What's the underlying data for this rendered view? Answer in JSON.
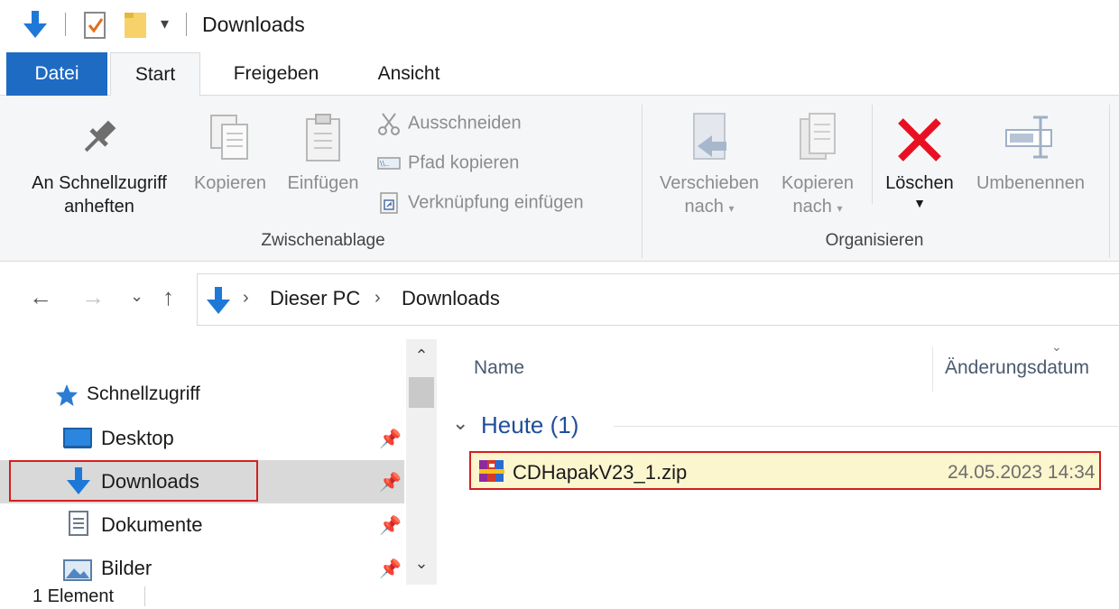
{
  "window": {
    "title": "Downloads"
  },
  "ribbon_tabs": [
    {
      "label": "Datei"
    },
    {
      "label": "Start"
    },
    {
      "label": "Freigeben"
    },
    {
      "label": "Ansicht"
    }
  ],
  "ribbon": {
    "pin_quick_access": {
      "line1": "An Schnellzugriff",
      "line2": "anheften"
    },
    "copy": "Kopieren",
    "paste": "Einfügen",
    "cut": "Ausschneiden",
    "copy_path": "Pfad kopieren",
    "paste_shortcut": "Verknüpfung einfügen",
    "clipboard_group": "Zwischenablage",
    "move_to": {
      "line1": "Verschieben",
      "line2": "nach"
    },
    "copy_to": {
      "line1": "Kopieren",
      "line2": "nach"
    },
    "delete": "Löschen",
    "rename": "Umbenennen",
    "organize_group": "Organisieren"
  },
  "address": {
    "breadcrumbs": [
      "Dieser PC",
      "Downloads"
    ]
  },
  "nav_pane": {
    "quick_access": "Schnellzugriff",
    "items": [
      {
        "label": "Desktop"
      },
      {
        "label": "Downloads"
      },
      {
        "label": "Dokumente"
      },
      {
        "label": "Bilder"
      }
    ]
  },
  "content": {
    "columns": {
      "name": "Name",
      "modified": "Änderungsdatum"
    },
    "group_header": "Heute (1)",
    "files": [
      {
        "name": "CDHapakV23_1.zip",
        "modified": "24.05.2023 14:34"
      }
    ]
  },
  "status": {
    "item_count": "1 Element"
  },
  "colors": {
    "file_tab": "#1e6bc4",
    "highlight_border": "#d41f1f",
    "selected_row": "#fcf6cf",
    "delete_icon": "#e81123",
    "group_header_text": "#1e4f99"
  }
}
